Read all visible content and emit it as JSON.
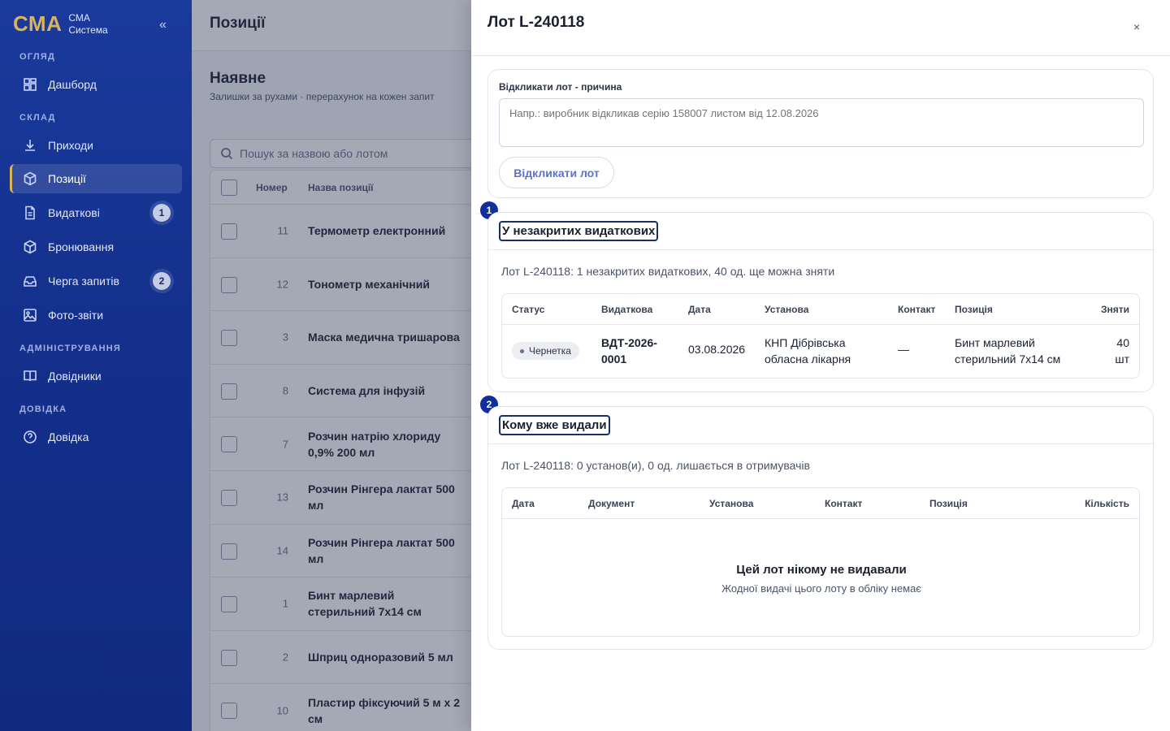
{
  "sidebar": {
    "brand_logo": "СМА",
    "brand_line1": "СМА",
    "brand_line2": "Система",
    "collapse_glyph": "«",
    "sections": {
      "overview": "ОГЛЯД",
      "warehouse": "СКЛАД",
      "admin": "АДМІНІСТРУВАННЯ",
      "help": "ДОВІДКА"
    },
    "items": [
      {
        "label": "Дашборд",
        "icon": "dashboard-icon"
      },
      {
        "label": "Приходи",
        "icon": "download-icon"
      },
      {
        "label": "Позиції",
        "icon": "box-icon",
        "active": true
      },
      {
        "label": "Видаткові",
        "icon": "document-icon",
        "badge": "1"
      },
      {
        "label": "Бронювання",
        "icon": "box-icon"
      },
      {
        "label": "Черга запитів",
        "icon": "inbox-icon",
        "badge": "2"
      },
      {
        "label": "Фото-звіти",
        "icon": "image-icon"
      },
      {
        "label": "Довідники",
        "icon": "book-icon"
      },
      {
        "label": "Довідка",
        "icon": "help-icon"
      }
    ]
  },
  "main": {
    "page_title": "Позиції",
    "section_title": "Наявне",
    "section_subtitle": "Залишки за рухами · перерахунок на кожен запит",
    "search_placeholder": "Пошук за назвою або лотом",
    "columns": {
      "number": "Номер",
      "name": "Назва позиції"
    },
    "rows": [
      {
        "num": "11",
        "name": "Термометр електронний"
      },
      {
        "num": "12",
        "name": "Тонометр механічний"
      },
      {
        "num": "3",
        "name": "Маска медична тришарова"
      },
      {
        "num": "8",
        "name": "Система для інфузій"
      },
      {
        "num": "7",
        "name": "Розчин натрію хлориду 0,9% 200 мл"
      },
      {
        "num": "13",
        "name": "Розчин Рінгера лактат 500 мл"
      },
      {
        "num": "14",
        "name": "Розчин Рінгера лактат 500 мл"
      },
      {
        "num": "1",
        "name": "Бинт марлевий стерильний 7х14 см"
      },
      {
        "num": "2",
        "name": "Шприц одноразовий 5 мл"
      },
      {
        "num": "10",
        "name": "Пластир фіксуючий 5 м х 2 см"
      }
    ]
  },
  "drawer": {
    "title": "Лот L-240118",
    "close_glyph": "×",
    "recall": {
      "label": "Відкликати лот - причина",
      "placeholder": "Напр.: виробник відкликав серію 158007 листом від 12.08.2026",
      "button": "Відкликати лот"
    },
    "open_docs": {
      "step": "1",
      "title": "У незакритих видаткових",
      "summary": "Лот L-240118: 1 незакритих видаткових, 40 од. ще можна зняти",
      "columns": {
        "status": "Статус",
        "doc": "Видаткова",
        "date": "Дата",
        "institution": "Установа",
        "contact": "Контакт",
        "item": "Позиція",
        "removed": "Зняти"
      },
      "rows": [
        {
          "status": "Чернетка",
          "doc": "ВДТ-2026-0001",
          "date": "03.08.2026",
          "institution": "КНП Дібрівська обласна лікарня",
          "contact": "—",
          "item": "Бинт марлевий стерильний 7х14 см",
          "qty": "40",
          "unit": "шт"
        }
      ]
    },
    "given": {
      "step": "2",
      "title": "Кому вже видали",
      "summary": "Лот L-240118: 0 установ(и), 0 од. лишається в отримувачів",
      "columns": {
        "date": "Дата",
        "doc": "Документ",
        "institution": "Установа",
        "contact": "Контакт",
        "item": "Позиція",
        "qty": "Кількість"
      },
      "empty_title": "Цей лот нікому не видавали",
      "empty_subtitle": "Жодної видачі цього лоту в обліку немає"
    }
  },
  "colors": {
    "sidebar_bg": "#14308c",
    "brand_gold": "#d8b45c",
    "step_badge": "#102f9a",
    "recall_button_text": "#5a74c9"
  }
}
